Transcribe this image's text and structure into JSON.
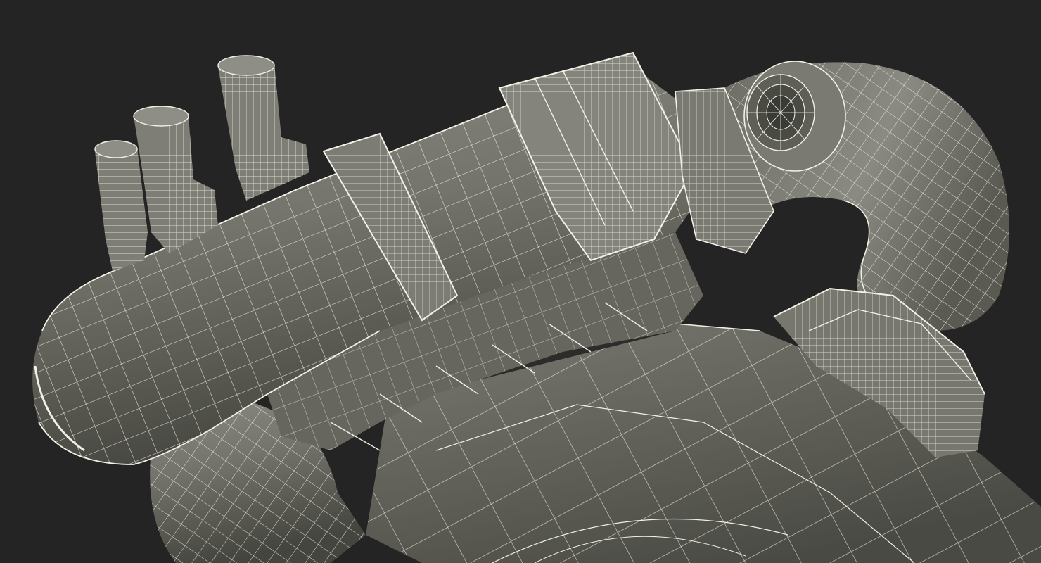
{
  "scene": {
    "subject": "wireframe-3d-render",
    "colors": {
      "background": "#242424",
      "surface": "#6f6f67",
      "surface_light": "#8a8a82",
      "surface_dark": "#3e3e3a",
      "wire": "#f2f1e6"
    }
  }
}
